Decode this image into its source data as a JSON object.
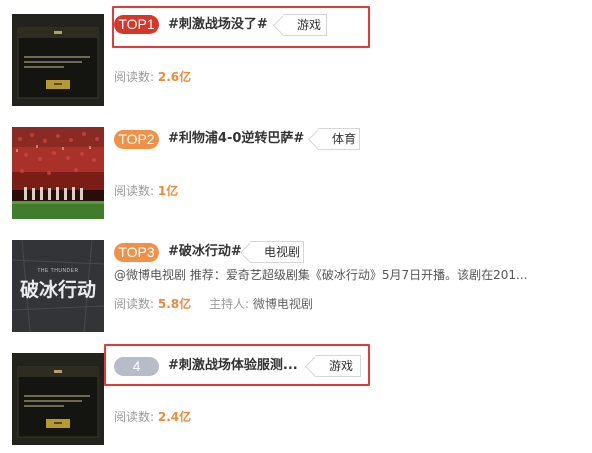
{
  "items": [
    {
      "rank": "TOP1",
      "title": "#刺激战场没了#",
      "tag": "游戏",
      "stats_label": "阅读数:",
      "stats_value": "2.6亿"
    },
    {
      "rank": "TOP2",
      "title": "#利物浦4-0逆转巴萨#",
      "tag": "体育",
      "stats_label": "阅读数:",
      "stats_value": "1亿"
    },
    {
      "rank": "TOP3",
      "title": "#破冰行动#",
      "tag": "电视剧",
      "description": "@微博电视剧 推荐：爱奇艺超级剧集《破冰行动》5月7日开播。该剧在201...",
      "stats_label": "阅读数:",
      "stats_value": "5.8亿",
      "host_label": "主持人:",
      "host_name": "微博电视剧",
      "thumb_text": "破冰行动",
      "thumb_subtext": "THE THUNDER"
    },
    {
      "rank": "4",
      "title": "#刺激战场体验服测...",
      "tag": "游戏",
      "stats_label": "阅读数:",
      "stats_value": "2.4亿"
    }
  ],
  "colors": {
    "top1": "#d9362a",
    "top2_top3": "#f19148",
    "rank_plain": "#b7bcc9",
    "stats_number": "#f08a3a",
    "highlight_box": "#e43a3a"
  },
  "icons": {
    "game_thumbnail": "game-dialog-thumbnail",
    "sports_thumbnail": "stadium-crowd-thumbnail",
    "tv_thumbnail": "tv-show-poster-thumbnail"
  }
}
